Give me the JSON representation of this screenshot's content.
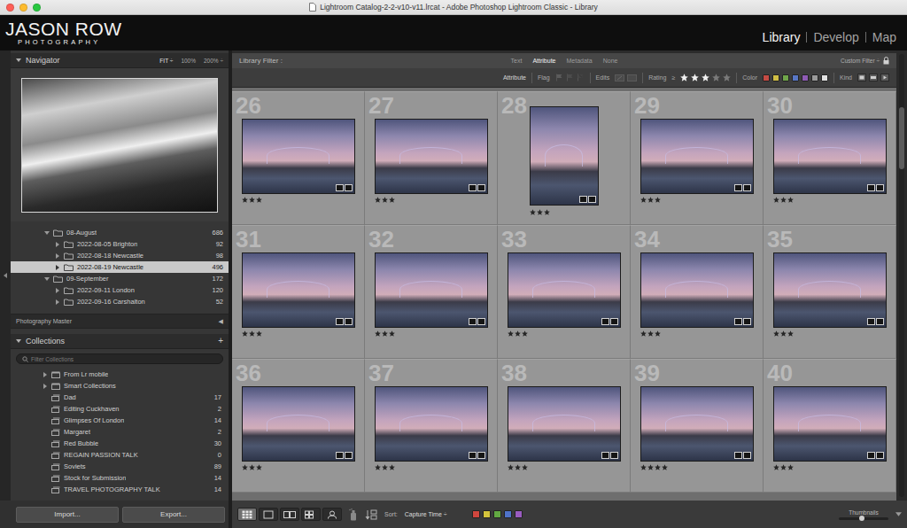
{
  "window": {
    "title": "Lightroom Catalog-2-2-v10-v11.lrcat - Adobe Photoshop Lightroom Classic - Library",
    "controls": [
      {
        "name": "close",
        "color": "#fe5f57"
      },
      {
        "name": "minimize",
        "color": "#febc2e"
      },
      {
        "name": "zoom",
        "color": "#28c840"
      }
    ]
  },
  "identity_plate": {
    "name": "JASON ROW",
    "subtitle": "PHOTOGRAPHY"
  },
  "modules": [
    {
      "label": "Library",
      "selected": true
    },
    {
      "label": "Develop",
      "selected": false
    },
    {
      "label": "Map",
      "selected": false
    }
  ],
  "navigator": {
    "title": "Navigator",
    "expanded": true,
    "zoom": [
      {
        "label": "FIT ÷",
        "selected": true
      },
      {
        "label": "100%",
        "selected": false
      },
      {
        "label": "200% ÷",
        "selected": false
      }
    ]
  },
  "folders": [
    {
      "name": "08-August",
      "count": "686",
      "kind": "month",
      "expanded": true,
      "selected": false
    },
    {
      "name": "2022-08-05 Brighton",
      "count": "92",
      "kind": "day",
      "expanded": false,
      "selected": false
    },
    {
      "name": "2022-08-18 Newcastle",
      "count": "98",
      "kind": "day",
      "expanded": false,
      "selected": false
    },
    {
      "name": "2022-08-19 Newcastle",
      "count": "496",
      "kind": "day",
      "expanded": false,
      "selected": true
    },
    {
      "name": "09-September",
      "count": "172",
      "kind": "month",
      "expanded": true,
      "selected": false
    },
    {
      "name": "2022-09-11 London",
      "count": "120",
      "kind": "day",
      "expanded": false,
      "selected": false
    },
    {
      "name": "2022-09-16 Carshalton",
      "count": "52",
      "kind": "day",
      "expanded": false,
      "selected": false
    }
  ],
  "source_bar": {
    "label": "Photography Master",
    "arrow": "◀"
  },
  "collections": {
    "title": "Collections",
    "expanded": true,
    "add": "+",
    "search_placeholder": "Filter Collections",
    "items": [
      {
        "name": "From Lr mobile",
        "kind": "set"
      },
      {
        "name": "Smart Collections",
        "kind": "set"
      },
      {
        "name": "Dad",
        "count": "17",
        "kind": "collection"
      },
      {
        "name": "Editing Cuckhaven",
        "count": "2",
        "kind": "collection"
      },
      {
        "name": "Glimpses Of London",
        "count": "14",
        "kind": "collection"
      },
      {
        "name": "Margaret",
        "count": "2",
        "kind": "collection"
      },
      {
        "name": "Red Bubble",
        "count": "30",
        "kind": "collection"
      },
      {
        "name": "REGAIN PASSION TALK",
        "count": "0",
        "kind": "collection"
      },
      {
        "name": "Soviets",
        "count": "89",
        "kind": "collection"
      },
      {
        "name": "Stock for Submission",
        "count": "14",
        "kind": "collection"
      },
      {
        "name": "TRAVEL PHOTOGRAPHY TALK",
        "count": "14",
        "kind": "collection"
      }
    ]
  },
  "library_filter": {
    "label": "Library Filter :",
    "tabs": [
      {
        "label": "Text",
        "selected": false
      },
      {
        "label": "Attribute",
        "selected": true
      },
      {
        "label": "Metadata",
        "selected": false
      },
      {
        "label": "None",
        "selected": false
      }
    ],
    "preset": "Custom Filter ÷",
    "locked": true
  },
  "attribute_bar": {
    "label": "Attribute",
    "flag_label": "Flag",
    "edits_label": "Edits",
    "rating_label": "Rating",
    "rating_operator": "≥",
    "stars": 3,
    "color_label": "Color",
    "colors": [
      {
        "color": "#c44b44"
      },
      {
        "color": "#cfbd45"
      },
      {
        "color": "#70a54a"
      },
      {
        "color": "#5876c4"
      },
      {
        "color": "#8e5bb4"
      },
      {
        "color": "#9a9a9a"
      },
      {
        "color": "#e2e2e2"
      }
    ],
    "kind_label": "Kind"
  },
  "grid": {
    "cells": [
      {
        "number": "26",
        "stars": 3,
        "kind": "landscape"
      },
      {
        "number": "27",
        "stars": 3,
        "kind": "landscape"
      },
      {
        "number": "28",
        "stars": 3,
        "kind": "portrait"
      },
      {
        "number": "29",
        "stars": 3,
        "kind": "landscape"
      },
      {
        "number": "30",
        "stars": 3,
        "kind": "landscape"
      },
      {
        "number": "31",
        "stars": 3,
        "kind": "landscape"
      },
      {
        "number": "32",
        "stars": 3,
        "kind": "landscape"
      },
      {
        "number": "33",
        "stars": 3,
        "kind": "landscape"
      },
      {
        "number": "34",
        "stars": 3,
        "kind": "landscape"
      },
      {
        "number": "35",
        "stars": 3,
        "kind": "landscape"
      },
      {
        "number": "36",
        "stars": 3,
        "kind": "landscape"
      },
      {
        "number": "37",
        "stars": 3,
        "kind": "landscape"
      },
      {
        "number": "38",
        "stars": 3,
        "kind": "landscape"
      },
      {
        "number": "39",
        "stars": 4,
        "kind": "landscape"
      },
      {
        "number": "40",
        "stars": 3,
        "kind": "landscape"
      }
    ]
  },
  "scrollbar": {
    "level": 0.12
  },
  "toolbar": {
    "views": [
      {
        "name": "grid",
        "selected": true
      },
      {
        "name": "loupe",
        "selected": false
      },
      {
        "name": "compare",
        "selected": false
      },
      {
        "name": "survey",
        "selected": false
      },
      {
        "name": "people",
        "selected": false
      }
    ],
    "sort_label": "Sort:",
    "sort_value": "Capture Time ÷",
    "label_colors": [
      {
        "color": "#d0463e"
      },
      {
        "color": "#d4c43c"
      },
      {
        "color": "#62a842"
      },
      {
        "color": "#4f73c8"
      },
      {
        "color": "#9a5cc0"
      }
    ],
    "thumbnails_label": "Thumbnails",
    "thumbnail_size": 0.45
  },
  "buttons": [
    {
      "label": "Import..."
    },
    {
      "label": "Export..."
    }
  ]
}
